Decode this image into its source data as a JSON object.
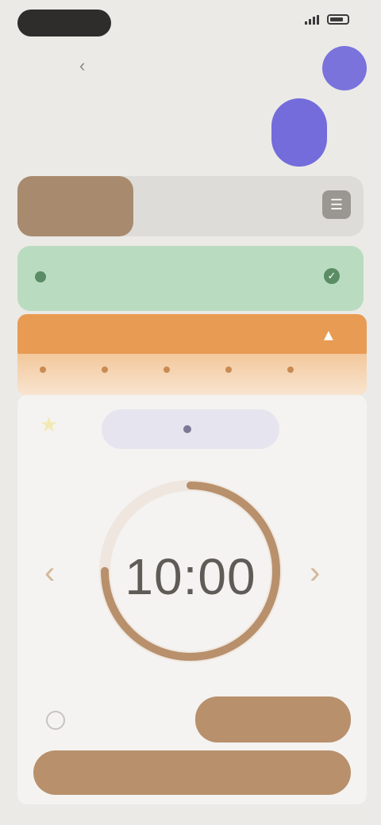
{
  "status_bar": {
    "time": "",
    "signal_icon": "signal-icon",
    "battery_icon": "battery-icon"
  },
  "nav": {
    "back_icon": "back-icon",
    "title": ""
  },
  "tabs": {
    "active_label": "",
    "inactive_label": "",
    "menu_icon": "menu-icon"
  },
  "banner": {
    "text": "",
    "check_icon": "check-icon",
    "color": "#b9dcc0"
  },
  "alert": {
    "arrow_icon": "arrow-up-icon",
    "color": "#e89b52"
  },
  "chip": {
    "label": "",
    "icon": "star-icon"
  },
  "counter": {
    "value": "10:00",
    "progress_fraction": 0.75,
    "ring_color": "#b8906c"
  },
  "buttons": {
    "secondary": "",
    "primary": ""
  },
  "colors": {
    "accent": "#b8906c",
    "purple": "#746cdb"
  }
}
